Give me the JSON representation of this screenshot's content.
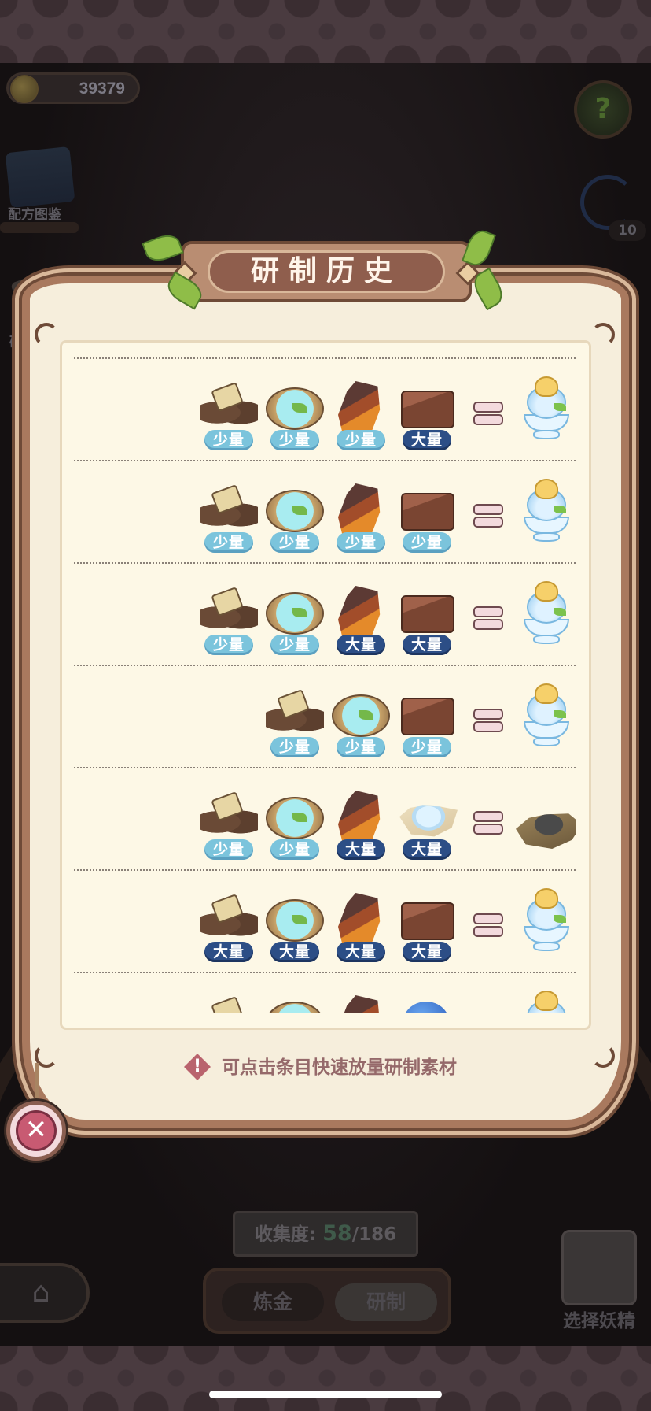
{
  "hud": {
    "coins": "39379",
    "recipe_book_label": "配方图鉴",
    "side_label": "研",
    "bulb_count": "10"
  },
  "modal": {
    "title": "研制历史",
    "hint": "可点击条目快速放量研制素材",
    "close_icon": "close-x-icon",
    "rows": [
      {
        "ingredients": [
          {
            "icon": "mud-ingredient-icon",
            "qty": "少量"
          },
          {
            "icon": "water-ingredient-icon",
            "qty": "少量"
          },
          {
            "icon": "crystal-ingredient-icon",
            "qty": "少量"
          },
          {
            "icon": "brick-ingredient-icon",
            "qty": "大量"
          }
        ],
        "result": "icecream-result-icon"
      },
      {
        "ingredients": [
          {
            "icon": "mud-ingredient-icon",
            "qty": "少量"
          },
          {
            "icon": "water-ingredient-icon",
            "qty": "少量"
          },
          {
            "icon": "crystal-ingredient-icon",
            "qty": "少量"
          },
          {
            "icon": "brick-ingredient-icon",
            "qty": "少量"
          }
        ],
        "result": "icecream-result-icon"
      },
      {
        "ingredients": [
          {
            "icon": "mud-ingredient-icon",
            "qty": "少量"
          },
          {
            "icon": "water-ingredient-icon",
            "qty": "少量"
          },
          {
            "icon": "crystal-ingredient-icon",
            "qty": "大量"
          },
          {
            "icon": "brick-ingredient-icon",
            "qty": "大量"
          }
        ],
        "result": "icecream-result-icon"
      },
      {
        "ingredients": [
          {
            "icon": "mud-ingredient-icon",
            "qty": "少量"
          },
          {
            "icon": "water-ingredient-icon",
            "qty": "少量"
          },
          {
            "icon": "brick-ingredient-icon",
            "qty": "少量"
          }
        ],
        "result": "icecream-result-icon"
      },
      {
        "ingredients": [
          {
            "icon": "mud-ingredient-icon",
            "qty": "少量"
          },
          {
            "icon": "water-ingredient-icon",
            "qty": "少量"
          },
          {
            "icon": "crystal-ingredient-icon",
            "qty": "大量"
          },
          {
            "icon": "salt-ingredient-icon",
            "qty": "大量"
          }
        ],
        "result": "coal-result-icon"
      },
      {
        "ingredients": [
          {
            "icon": "mud-ingredient-icon",
            "qty": "大量"
          },
          {
            "icon": "water-ingredient-icon",
            "qty": "大量"
          },
          {
            "icon": "crystal-ingredient-icon",
            "qty": "大量"
          },
          {
            "icon": "brick-ingredient-icon",
            "qty": "大量"
          }
        ],
        "result": "icecream-result-icon"
      },
      {
        "ingredients": [
          {
            "icon": "mud-ingredient-icon",
            "qty": ""
          },
          {
            "icon": "water-ingredient-icon",
            "qty": ""
          },
          {
            "icon": "crystal-ingredient-icon",
            "qty": ""
          },
          {
            "icon": "blue-ingredient-icon",
            "qty": ""
          }
        ],
        "result": "icecream-result-icon"
      }
    ]
  },
  "bottom": {
    "collection_label": "收集度:",
    "collection_value": "58",
    "collection_total": "/186",
    "tab_alchemy": "炼金",
    "tab_craft": "研制",
    "fairy_label": "选择妖精",
    "home_icon": "home-icon"
  },
  "colors": {
    "small_badge": "#7bc4dc",
    "large_badge": "#2c4e86",
    "modal_bg": "#f6eedc",
    "title_banner": "#8f5e4d",
    "close_button": "#c85a72"
  }
}
